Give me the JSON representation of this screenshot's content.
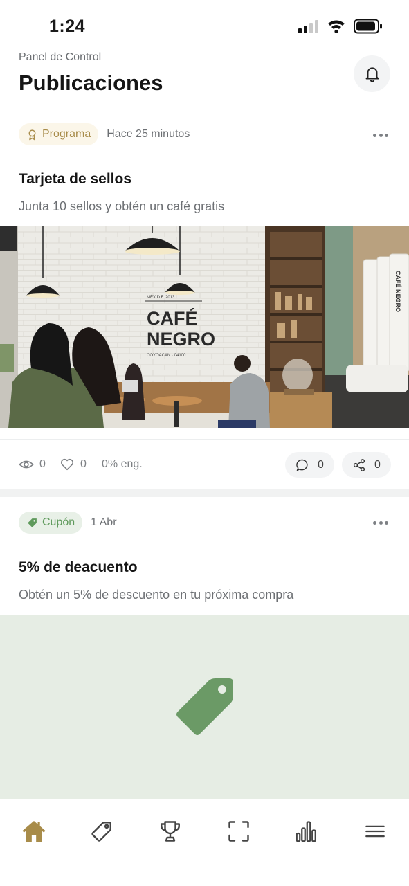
{
  "status_bar": {
    "time": "1:24"
  },
  "header": {
    "breadcrumb": "Panel de Control",
    "title": "Publicaciones"
  },
  "posts": [
    {
      "badge": "Programa",
      "time": "Hace 25 minutos",
      "title": "Tarjeta de sellos",
      "description": "Junta 10 sellos y obtén un café gratis",
      "image_sign": {
        "line1": "CAFÉ",
        "line2": "NEGRO",
        "top": "MÉX   D.F.   2013",
        "bottom": "COYOACAN · 04100"
      },
      "stats": {
        "views": "0",
        "likes": "0",
        "engagement": "0% eng.",
        "comments": "0",
        "shares": "0"
      }
    },
    {
      "badge": "Cupón",
      "time": "1 Abr",
      "title": "5% de deacuento",
      "description": "Obtén un 5% de descuento en tu próxima compra"
    }
  ],
  "colors": {
    "accent_gold": "#a88c4a",
    "coupon_green": "#6b9a66",
    "coupon_bg": "#e6ede4"
  },
  "tabbar": {
    "icons": [
      "home-icon",
      "tag-icon",
      "trophy-icon",
      "scan-icon",
      "chart-icon",
      "menu-icon"
    ],
    "active": "home-icon"
  }
}
